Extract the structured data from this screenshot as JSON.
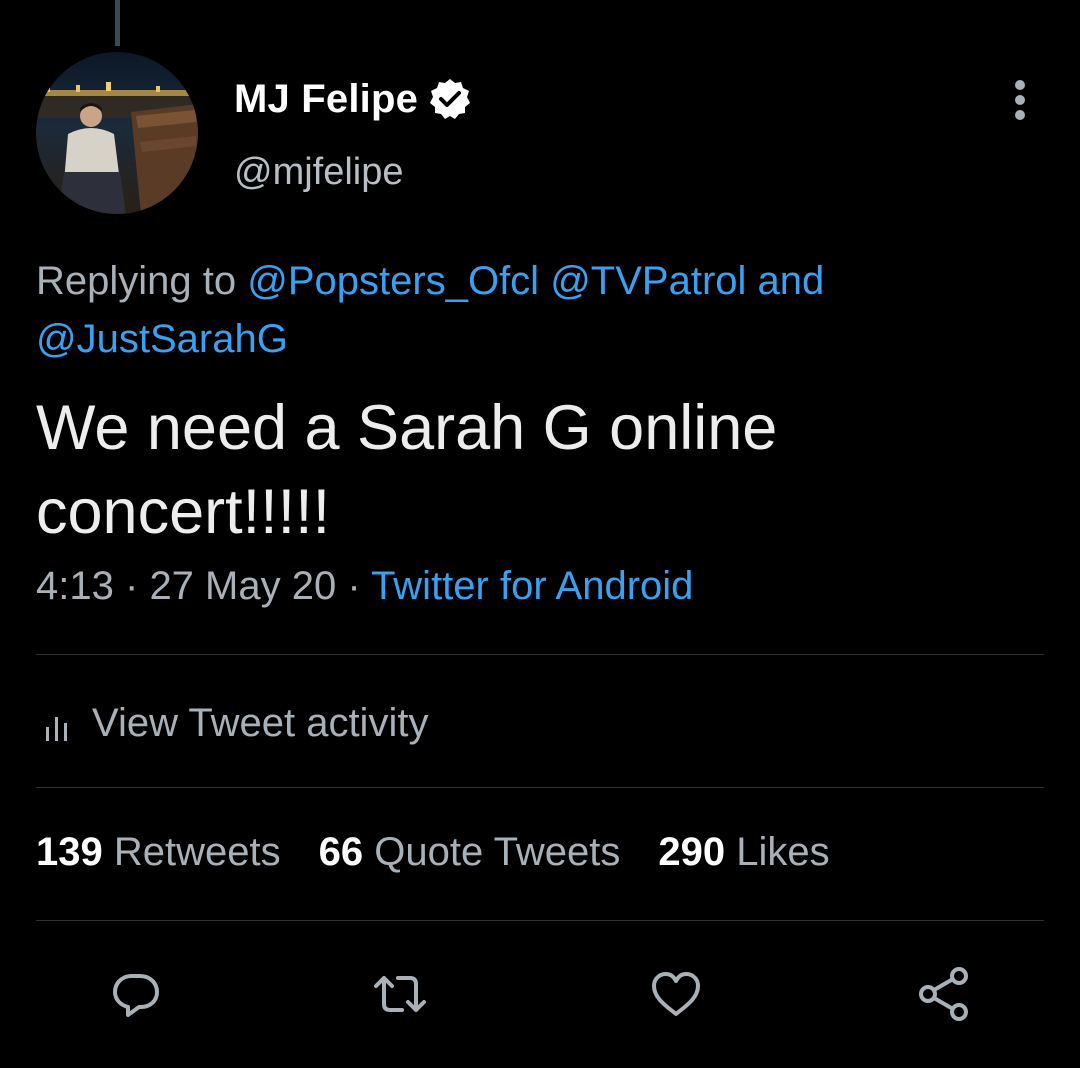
{
  "author": {
    "display_name": "MJ Felipe",
    "handle": "@mjfelipe",
    "verified": true
  },
  "reply": {
    "prefix": "Replying to",
    "mentions": [
      "@Popsters_Ofcl",
      "@TVPatrol",
      "@JustSarahG"
    ],
    "joiner": "and"
  },
  "tweet": {
    "text": "We need a Sarah G online concert!!!!!",
    "time": "4:13",
    "date": "27 May 20",
    "separator": "·",
    "source": "Twitter for Android"
  },
  "activity": {
    "label": "View Tweet activity",
    "icon": "analytics-bars-icon"
  },
  "stats": [
    {
      "count": "139",
      "label": "Retweets"
    },
    {
      "count": "66",
      "label": "Quote Tweets"
    },
    {
      "count": "290",
      "label": "Likes"
    }
  ],
  "actions": [
    {
      "name": "reply",
      "icon": "reply-bubble-icon"
    },
    {
      "name": "retweet",
      "icon": "retweet-arrows-icon"
    },
    {
      "name": "like",
      "icon": "heart-icon"
    },
    {
      "name": "share",
      "icon": "share-nodes-icon"
    }
  ],
  "colors": {
    "background": "#000000",
    "link": "#3aa0f2",
    "secondary_text": "#a8b1b8",
    "divider": "#2f3336"
  }
}
